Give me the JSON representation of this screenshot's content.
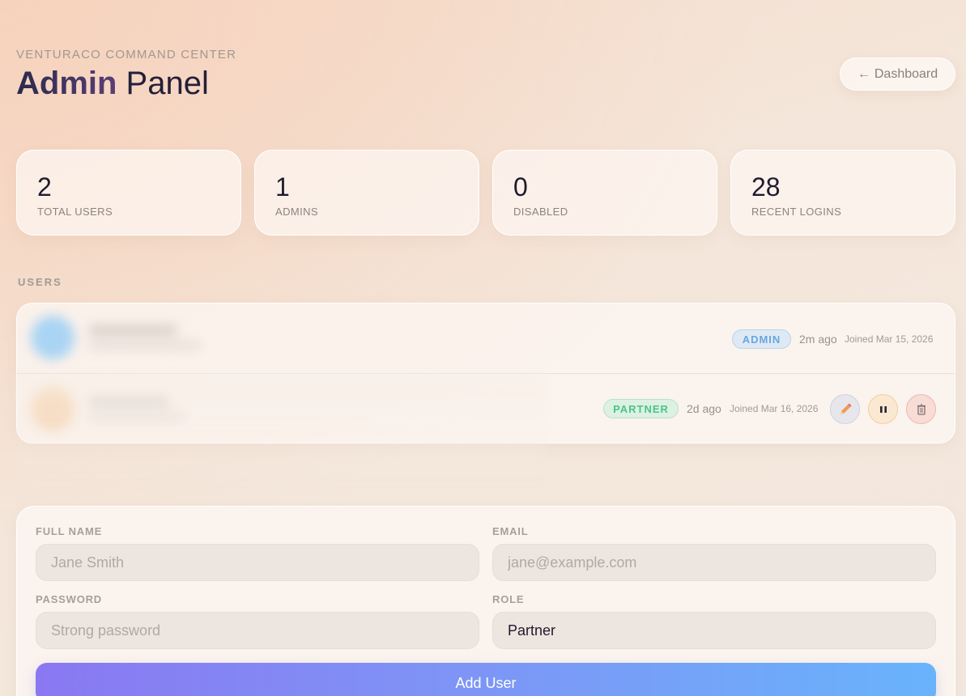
{
  "header": {
    "eyebrow": "VENTURACO COMMAND CENTER",
    "title_strong": "Admin",
    "title_rest": " Panel",
    "back_label": "Dashboard",
    "back_arrow": "←"
  },
  "stats": [
    {
      "value": "2",
      "label": "TOTAL USERS"
    },
    {
      "value": "1",
      "label": "ADMINS"
    },
    {
      "value": "0",
      "label": "DISABLED"
    },
    {
      "value": "28",
      "label": "RECENT LOGINS"
    }
  ],
  "users_section": {
    "title": "USERS",
    "rows": [
      {
        "role": "ADMIN",
        "last_active": "2m ago",
        "joined": "Joined Mar 15, 2026",
        "avatar_color": "#a9d4f3"
      },
      {
        "role": "PARTNER",
        "last_active": "2d ago",
        "joined": "Joined Mar 16, 2026",
        "avatar_color": "#f7d4b1",
        "actions": [
          "edit",
          "pause",
          "delete"
        ]
      }
    ]
  },
  "form": {
    "full_name": {
      "label": "FULL NAME",
      "placeholder": "Jane Smith",
      "value": ""
    },
    "email": {
      "label": "EMAIL",
      "placeholder": "jane@example.com",
      "value": ""
    },
    "password": {
      "label": "PASSWORD",
      "placeholder": "Strong password",
      "value": ""
    },
    "role": {
      "label": "ROLE",
      "selected": "Partner"
    },
    "submit_label": "Add User"
  },
  "colors": {
    "accent_start": "#8a78f2",
    "accent_end": "#69b3fb",
    "admin_badge": "#67a7e0",
    "partner_badge": "#4cc48a"
  }
}
